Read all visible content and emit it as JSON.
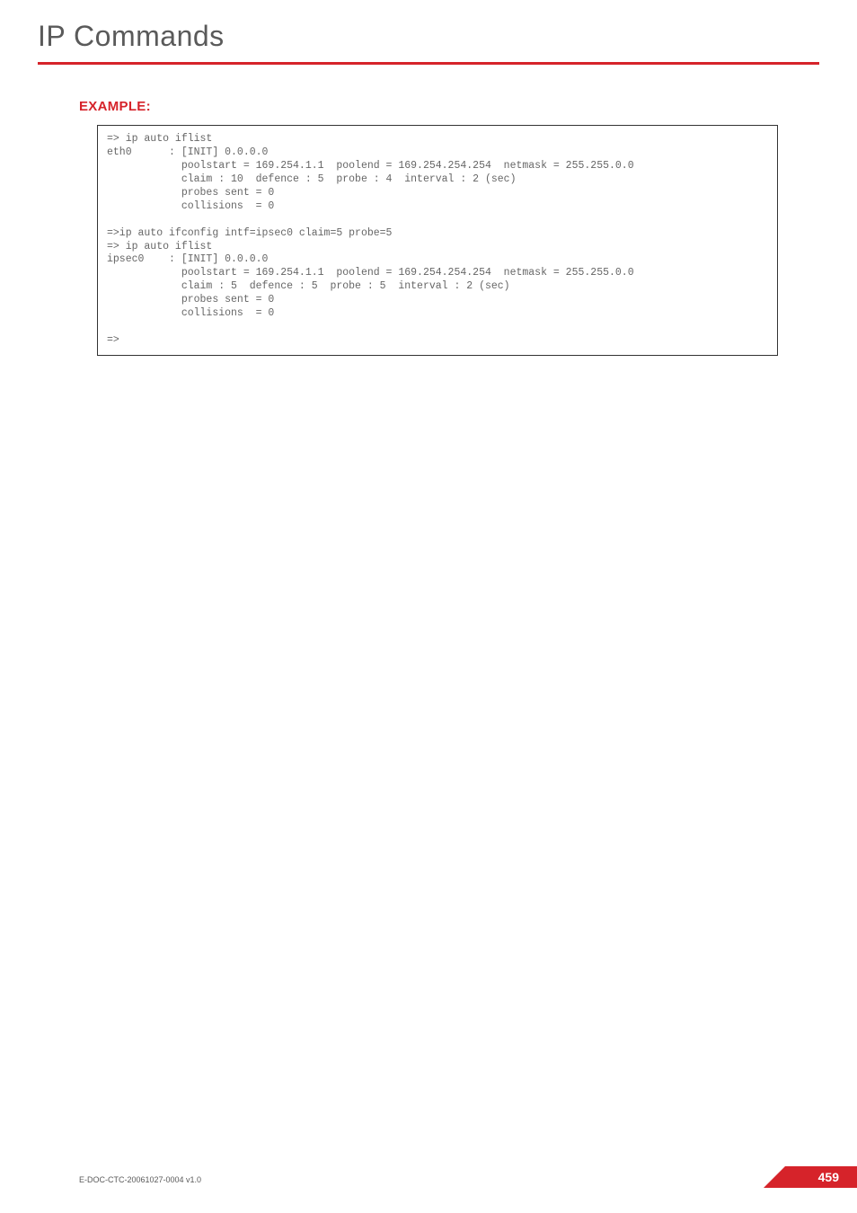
{
  "header": {
    "title": "IP Commands"
  },
  "section": {
    "example_label": "EXAMPLE:"
  },
  "code": {
    "text": "=> ip auto iflist\neth0      : [INIT] 0.0.0.0\n            poolstart = 169.254.1.1  poolend = 169.254.254.254  netmask = 255.255.0.0\n            claim : 10  defence : 5  probe : 4  interval : 2 (sec)\n            probes sent = 0\n            collisions  = 0\n\n=>ip auto ifconfig intf=ipsec0 claim=5 probe=5\n=> ip auto iflist\nipsec0    : [INIT] 0.0.0.0\n            poolstart = 169.254.1.1  poolend = 169.254.254.254  netmask = 255.255.0.0\n            claim : 5  defence : 5  probe : 5  interval : 2 (sec)\n            probes sent = 0\n            collisions  = 0\n\n=>"
  },
  "footer": {
    "doc_id": "E-DOC-CTC-20061027-0004 v1.0",
    "page": "459"
  }
}
